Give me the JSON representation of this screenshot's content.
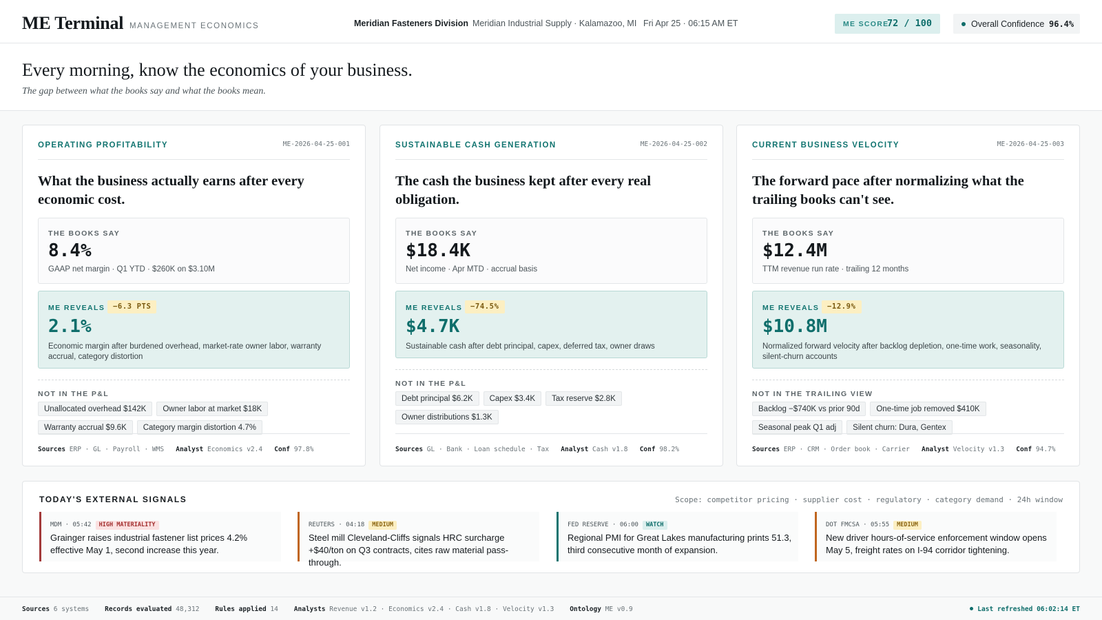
{
  "header": {
    "brand": "ME Terminal",
    "brand_sub": "MANAGEMENT ECONOMICS",
    "division": "Meridian Fasteners Division",
    "company": "Meridian Industrial Supply · Kalamazoo, MI",
    "datetime": "Fri Apr 25 · 06:15 AM ET",
    "score_label": "ME SCORE",
    "score_value": "72 / 100",
    "confidence_label": "Overall Confidence",
    "confidence_value": "96.4%"
  },
  "hero": {
    "title": "Every morning, know the economics of your business.",
    "subtitle": "The gap between what the books say and what the books mean."
  },
  "cards": [
    {
      "label": "OPERATING PROFITABILITY",
      "id": "ME-2026-04-25-001",
      "question": "What the business actually earns after every economic cost.",
      "books_label": "THE BOOKS SAY",
      "books_value": "8.4%",
      "books_note": "GAAP net margin · Q1 YTD · $260K on $3.10M",
      "reveal_label": "ME REVEALS",
      "reveal_delta": "−6.3 PTS",
      "reveal_value": "2.1%",
      "reveal_note": "Economic margin after burdened overhead, market-rate owner labor, warranty accrual, category distortion",
      "missing_label": "NOT IN THE P&L",
      "chips": [
        "Unallocated overhead $142K",
        "Owner labor at market $18K",
        "Warranty accrual $9.6K",
        "Category margin distortion 4.7%"
      ],
      "sources": "ERP · GL · Payroll · WMS",
      "analyst": "Economics v2.4",
      "conf": "97.8%"
    },
    {
      "label": "SUSTAINABLE CASH GENERATION",
      "id": "ME-2026-04-25-002",
      "question": "The cash the business kept after every real obligation.",
      "books_label": "THE BOOKS SAY",
      "books_value": "$18.4K",
      "books_note": "Net income · Apr MTD · accrual basis",
      "reveal_label": "ME REVEALS",
      "reveal_delta": "−74.5%",
      "reveal_value": "$4.7K",
      "reveal_note": "Sustainable cash after debt principal, capex, deferred tax, owner draws",
      "missing_label": "NOT IN THE P&L",
      "chips": [
        "Debt principal $6.2K",
        "Capex $3.4K",
        "Tax reserve $2.8K",
        "Owner distributions $1.3K"
      ],
      "sources": "GL · Bank · Loan schedule · Tax",
      "analyst": "Cash v1.8",
      "conf": "98.2%"
    },
    {
      "label": "CURRENT BUSINESS VELOCITY",
      "id": "ME-2026-04-25-003",
      "question": "The forward pace after normalizing what the trailing books can't see.",
      "books_label": "THE BOOKS SAY",
      "books_value": "$12.4M",
      "books_note": "TTM revenue run rate · trailing 12 months",
      "reveal_label": "ME REVEALS",
      "reveal_delta": "−12.9%",
      "reveal_value": "$10.8M",
      "reveal_note": "Normalized forward velocity after backlog depletion, one-time work, seasonality, silent-churn accounts",
      "missing_label": "NOT IN THE TRAILING VIEW",
      "chips": [
        "Backlog −$740K vs prior 90d",
        "One-time job removed $410K",
        "Seasonal peak Q1 adj",
        "Silent churn: Dura, Gentex"
      ],
      "sources": "ERP · CRM · Order book · Carrier",
      "analyst": "Velocity v1.3",
      "conf": "94.7%"
    }
  ],
  "card_labels": {
    "sources": "Sources",
    "analyst": "Analyst",
    "conf": "Conf"
  },
  "signals": {
    "title": "TODAY'S EXTERNAL SIGNALS",
    "scope": "Scope: competitor pricing · supplier cost · regulatory · category demand · 24h window",
    "items": [
      {
        "source": "MDM · 05:42",
        "tag": "HIGH MATERIALITY",
        "tag_level": "high",
        "border": "#a33a3a",
        "text": "Grainger raises industrial fastener list prices 4.2% effective May 1, second increase this year."
      },
      {
        "source": "REUTERS · 04:18",
        "tag": "MEDIUM",
        "tag_level": "med",
        "border": "#c0661f",
        "text": "Steel mill Cleveland-Cliffs signals HRC surcharge +$40/ton on Q3 contracts, cites raw material pass-through."
      },
      {
        "source": "FED RESERVE · 06:00",
        "tag": "WATCH",
        "tag_level": "watch",
        "border": "#117470",
        "text": "Regional PMI for Great Lakes manufacturing prints 51.3, third consecutive month of expansion."
      },
      {
        "source": "DOT FMCSA · 05:55",
        "tag": "MEDIUM",
        "tag_level": "med",
        "border": "#c0661f",
        "text": "New driver hours-of-service enforcement window opens May 5, freight rates on I-94 corridor tightening."
      }
    ]
  },
  "footer": {
    "sources_label": "Sources",
    "sources_value": "6 systems",
    "records_label": "Records evaluated",
    "records_value": "48,312",
    "rules_label": "Rules applied",
    "rules_value": "14",
    "analysts_label": "Analysts",
    "analysts_value": "Revenue v1.2 · Economics v2.4 · Cash v1.8 · Velocity v1.3",
    "ontology_label": "Ontology",
    "ontology_value": "ME v0.9",
    "refreshed": "Last refreshed 06:02:14 ET"
  },
  "colors": {
    "accent": "#117470",
    "reveal_bg": "#e3f1ef",
    "delta_bg": "#fcefc2",
    "high": "#a33a3a",
    "medium": "#c0661f"
  }
}
